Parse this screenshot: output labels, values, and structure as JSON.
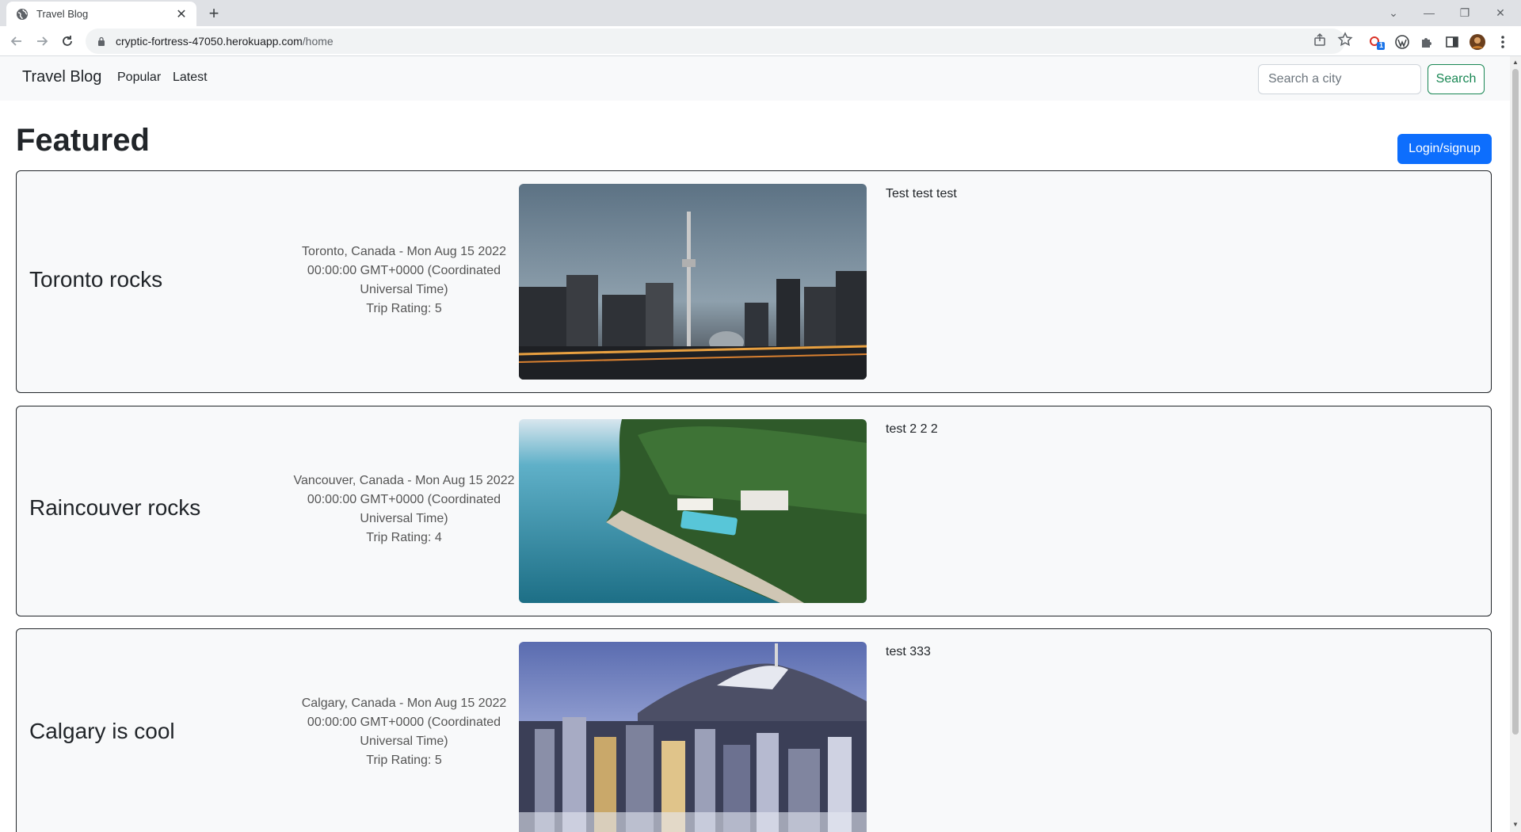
{
  "browser": {
    "tab_title": "Travel Blog",
    "url_host": "cryptic-fortress-47050.herokuapp.com",
    "url_path": "/home",
    "extension_badge": "1"
  },
  "nav": {
    "brand": "Travel Blog",
    "links": [
      "Popular",
      "Latest"
    ],
    "search_placeholder": "Search a city",
    "search_button": "Search"
  },
  "page": {
    "heading": "Featured",
    "login_button": "Login/signup"
  },
  "posts": [
    {
      "title": "Toronto rocks",
      "meta_line1": "Toronto, Canada - Mon Aug 15 2022",
      "meta_line2": "00:00:00 GMT+0000 (Coordinated",
      "meta_line3": "Universal Time)",
      "rating": "Trip Rating: 5",
      "description": "Test test test",
      "image": "toronto-skyline-photo"
    },
    {
      "title": "Raincouver rocks",
      "meta_line1": "Vancouver, Canada - Mon Aug 15 2022",
      "meta_line2": "00:00:00 GMT+0000 (Coordinated",
      "meta_line3": "Universal Time)",
      "rating": "Trip Rating: 4",
      "description": "test 2 2 2",
      "image": "coastal-resort-photo"
    },
    {
      "title": "Calgary is cool",
      "meta_line1": "Calgary, Canada - Mon Aug 15 2022",
      "meta_line2": "00:00:00 GMT+0000 (Coordinated",
      "meta_line3": "Universal Time)",
      "rating": "Trip Rating: 5",
      "description": "test 333",
      "image": "city-mountain-photo"
    }
  ],
  "colors": {
    "primary": "#0d6efd",
    "success": "#198754",
    "navbar_bg": "#f8f9fa"
  }
}
